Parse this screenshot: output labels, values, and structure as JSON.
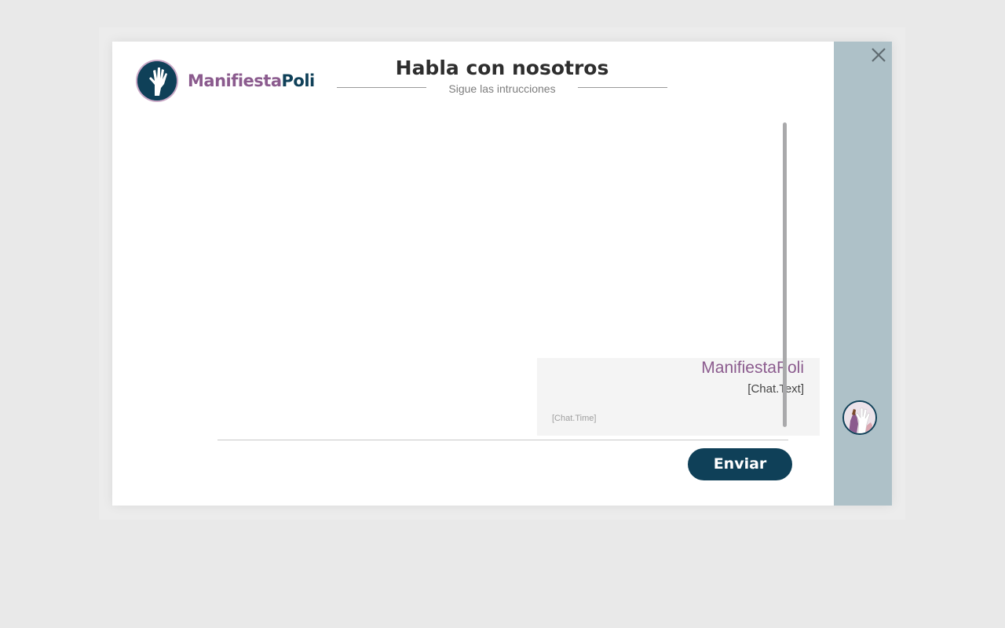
{
  "window": {
    "close_icon": "close-icon"
  },
  "brand": {
    "name_part1": "Manifiesta",
    "name_part2": "Poli",
    "emblem_icon": "raised-hand-icon",
    "colors": {
      "purple": "#8b5b8e",
      "navy": "#0f4058",
      "side_panel": "#aec1c8"
    }
  },
  "header": {
    "title": "Habla con nosotros",
    "subtitle": "Sigue las intrucciones"
  },
  "chat": {
    "messages": [
      {
        "sender": "ManifiestaPoli",
        "text": "[Chat.Text]",
        "time": "[Chat.Time]",
        "avatar_icon": "hands-avatar-icon"
      }
    ]
  },
  "composer": {
    "send_label": "Enviar"
  }
}
